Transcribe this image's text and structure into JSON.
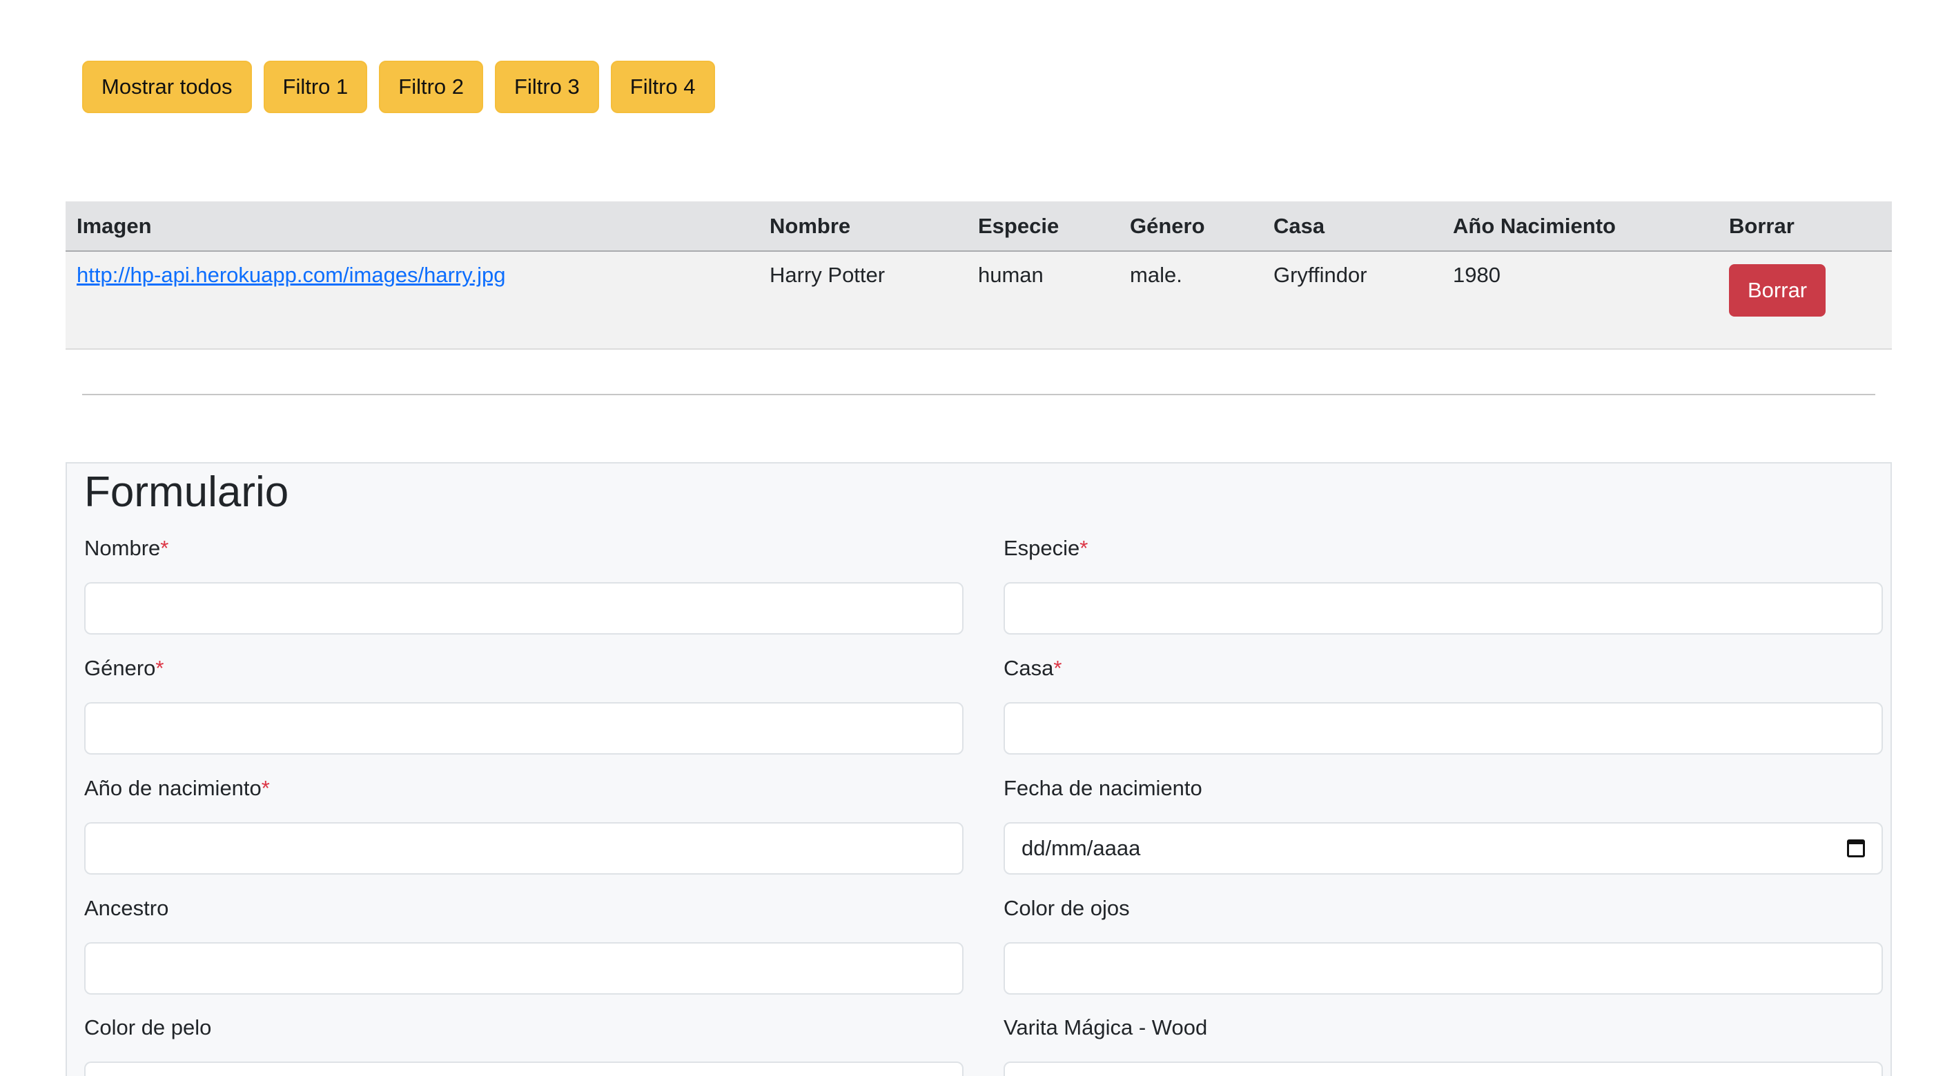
{
  "filters": {
    "show_all": "Mostrar todos",
    "f1": "Filtro 1",
    "f2": "Filtro 2",
    "f3": "Filtro 3",
    "f4": "Filtro 4"
  },
  "table": {
    "headers": {
      "imagen": "Imagen",
      "nombre": "Nombre",
      "especie": "Especie",
      "genero": "Género",
      "casa": "Casa",
      "anio": "Año Nacimiento",
      "borrar": "Borrar"
    },
    "rows": [
      {
        "imagen": "http://hp-api.herokuapp.com/images/harry.jpg",
        "nombre": "Harry Potter",
        "especie": "human",
        "genero": "male.",
        "casa": "Gryffindor",
        "anio": "1980",
        "borrar_label": "Borrar"
      }
    ]
  },
  "form": {
    "title": "Formulario",
    "required_mark": "*",
    "fields": {
      "nombre": {
        "label": "Nombre",
        "value": ""
      },
      "especie": {
        "label": "Especie",
        "value": ""
      },
      "genero": {
        "label": "Género",
        "value": ""
      },
      "casa": {
        "label": "Casa",
        "value": ""
      },
      "anio": {
        "label": "Año de nacimiento",
        "value": ""
      },
      "fecha": {
        "label": "Fecha de nacimiento",
        "placeholder": "dd/mm/aaaa"
      },
      "ancestro": {
        "label": "Ancestro",
        "value": ""
      },
      "ojos": {
        "label": "Color de ojos",
        "value": ""
      },
      "pelo": {
        "label": "Color de pelo",
        "value": ""
      },
      "varita_wood": {
        "label": "Varita Mágica - Wood",
        "value": ""
      }
    }
  },
  "colors": {
    "warning": "#f7c244",
    "danger": "#ca3b47",
    "link": "#0d6efd",
    "required": "#dc3545"
  }
}
